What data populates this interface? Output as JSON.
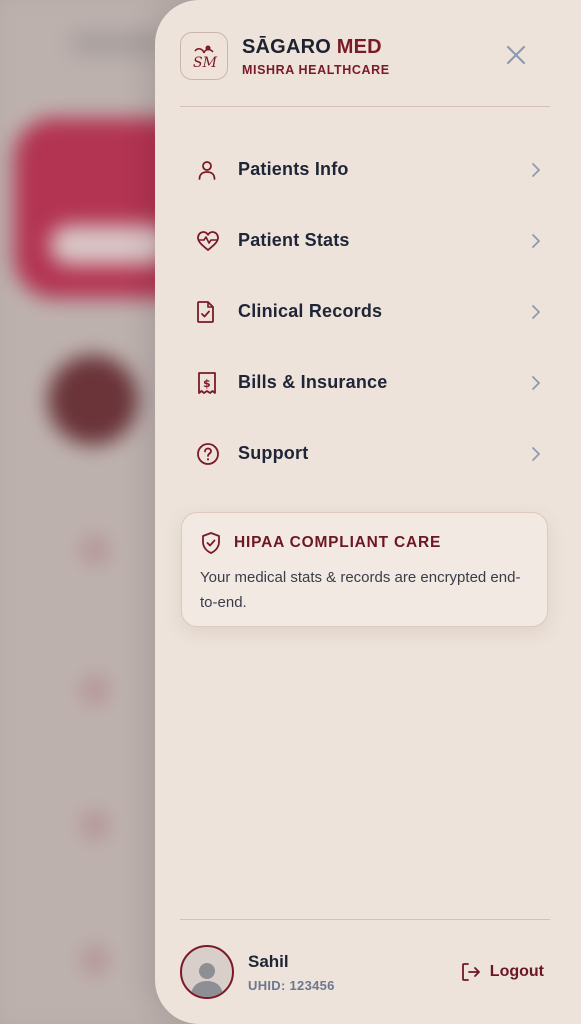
{
  "brand": {
    "logo_text": "SM",
    "name_main": "SĀGARO",
    "name_accent": "MED",
    "subtitle": "MISHRA HEALTHCARE"
  },
  "menu": [
    {
      "label": "Patients Info",
      "icon": "user-icon"
    },
    {
      "label": "Patient Stats",
      "icon": "heart-pulse-icon"
    },
    {
      "label": "Clinical Records",
      "icon": "document-check-icon"
    },
    {
      "label": "Bills & Insurance",
      "icon": "receipt-dollar-icon"
    },
    {
      "label": "Support",
      "icon": "help-circle-icon"
    }
  ],
  "hipaa": {
    "title": "HIPAA COMPLIANT CARE",
    "text": "Your medical stats & records are encrypted end-to-end."
  },
  "user": {
    "name": "Sahil",
    "uhid": "UHID: 123456"
  },
  "logout_label": "Logout",
  "colors": {
    "accent": "#7a1a27",
    "drawer_bg": "#ede3da",
    "text": "#1f2536"
  }
}
